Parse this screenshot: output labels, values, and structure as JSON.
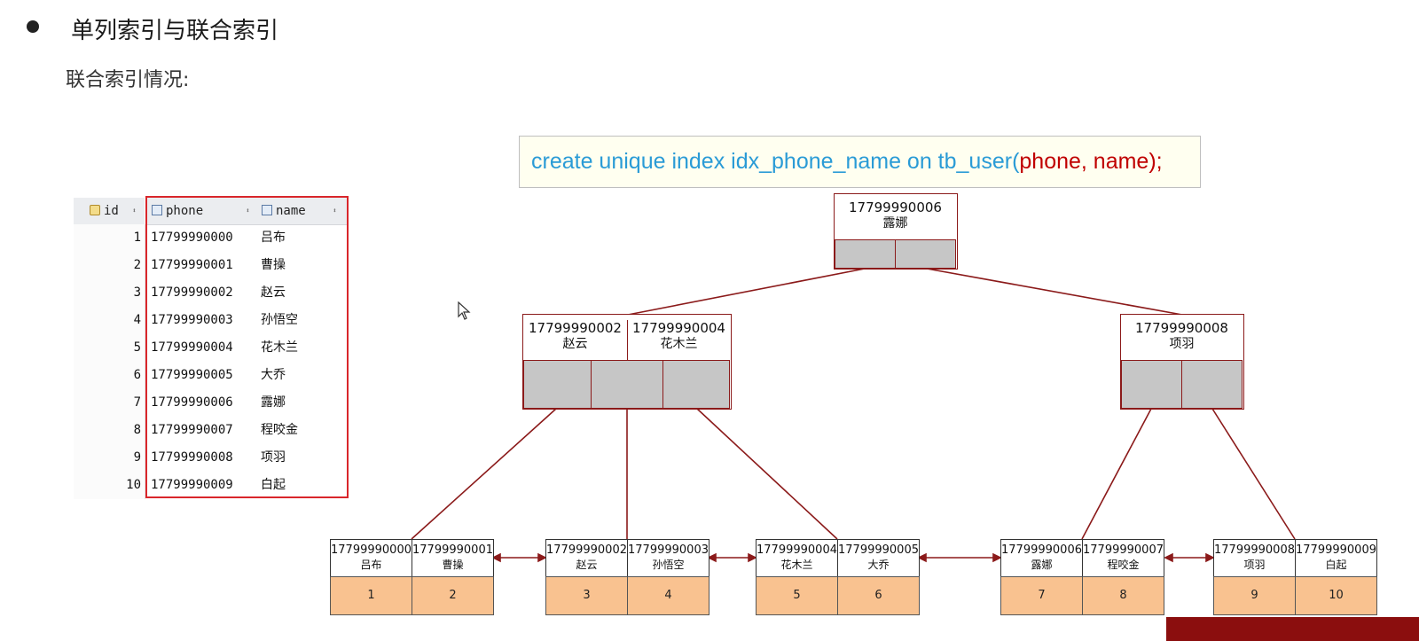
{
  "title": "单列索引与联合索引",
  "subtitle": "联合索引情况:",
  "table": {
    "columns": [
      {
        "label": "id",
        "icon": "key-column-icon"
      },
      {
        "label": "phone",
        "icon": "column-icon"
      },
      {
        "label": "name",
        "icon": "column-icon"
      }
    ],
    "rows": [
      {
        "id": "1",
        "phone": "17799990000",
        "name": "吕布"
      },
      {
        "id": "2",
        "phone": "17799990001",
        "name": "曹操"
      },
      {
        "id": "3",
        "phone": "17799990002",
        "name": "赵云"
      },
      {
        "id": "4",
        "phone": "17799990003",
        "name": "孙悟空"
      },
      {
        "id": "5",
        "phone": "17799990004",
        "name": "花木兰"
      },
      {
        "id": "6",
        "phone": "17799990005",
        "name": "大乔"
      },
      {
        "id": "7",
        "phone": "17799990006",
        "name": "露娜"
      },
      {
        "id": "8",
        "phone": "17799990007",
        "name": "程咬金"
      },
      {
        "id": "9",
        "phone": "17799990008",
        "name": "项羽"
      },
      {
        "id": "10",
        "phone": "17799990009",
        "name": "白起"
      }
    ]
  },
  "sql": {
    "prefix": "create unique index idx_phone_name on tb_user(",
    "columns": "phone, name",
    "suffix": ");"
  },
  "tree": {
    "root": {
      "keys": [
        {
          "phone": "17799990006",
          "name": "露娜"
        }
      ]
    },
    "level2": [
      {
        "keys": [
          {
            "phone": "17799990002",
            "name": "赵云"
          },
          {
            "phone": "17799990004",
            "name": "花木兰"
          }
        ]
      },
      {
        "keys": [
          {
            "phone": "17799990008",
            "name": "项羽"
          }
        ]
      }
    ],
    "leaves": [
      {
        "entries": [
          {
            "phone": "17799990000",
            "name": "吕布",
            "id": "1"
          },
          {
            "phone": "17799990001",
            "name": "曹操",
            "id": "2"
          }
        ]
      },
      {
        "entries": [
          {
            "phone": "17799990002",
            "name": "赵云",
            "id": "3"
          },
          {
            "phone": "17799990003",
            "name": "孙悟空",
            "id": "4"
          }
        ]
      },
      {
        "entries": [
          {
            "phone": "17799990004",
            "name": "花木兰",
            "id": "5"
          },
          {
            "phone": "17799990005",
            "name": "大乔",
            "id": "6"
          }
        ]
      },
      {
        "entries": [
          {
            "phone": "17799990006",
            "name": "露娜",
            "id": "7"
          },
          {
            "phone": "17799990007",
            "name": "程咬金",
            "id": "8"
          }
        ]
      },
      {
        "entries": [
          {
            "phone": "17799990008",
            "name": "项羽",
            "id": "9"
          },
          {
            "phone": "17799990009",
            "name": "白起",
            "id": "10"
          }
        ]
      }
    ]
  },
  "colors": {
    "sql_text": "#2a9bd6",
    "sql_highlight": "#c00000",
    "node_border": "#8b1a1a",
    "pointer_fill": "#c6c6c6",
    "leaf_row_fill": "#f9c290",
    "table_highlight_border": "#d9262b"
  }
}
